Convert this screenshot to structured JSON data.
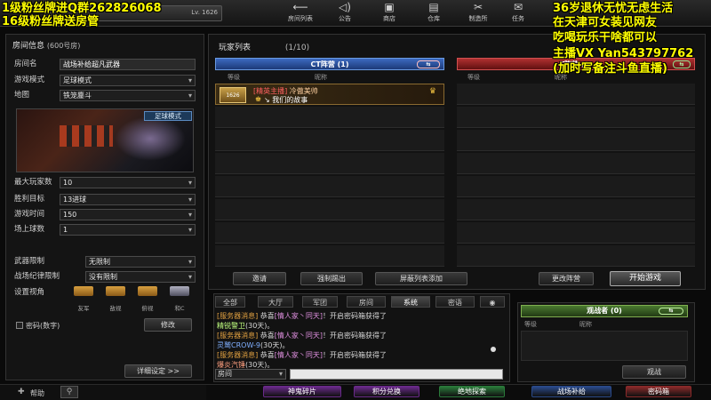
{
  "overlay": {
    "left_lines": [
      "1级粉丝牌进Q群262826068",
      "16级粉丝牌送房管"
    ],
    "right_lines": [
      "36岁退休无忧无虑生活",
      "在天津可女装见网友",
      "吃喝玩乐干啥都可以",
      "主播VX Yan543797762",
      "(加时写备注斗鱼直播)"
    ]
  },
  "topbar": {
    "level": "Lv. 1626",
    "nav": [
      {
        "label": "房间列表",
        "icon": "back-arrow-icon",
        "glyph": "⟵"
      },
      {
        "label": "公告",
        "icon": "speaker-icon",
        "glyph": "◁)"
      },
      {
        "label": "商店",
        "icon": "shop-icon",
        "glyph": "▣"
      },
      {
        "label": "仓库",
        "icon": "warehouse-icon",
        "glyph": "▤"
      },
      {
        "label": "制造所",
        "icon": "tools-icon",
        "glyph": "✂"
      },
      {
        "label": "任务",
        "icon": "mission-icon",
        "glyph": "✉"
      }
    ]
  },
  "room_info": {
    "title": "房间信息",
    "room_no": "(600号房)",
    "fields": [
      {
        "label": "房间名",
        "value": "战场补给超凡武器",
        "kind": "title"
      },
      {
        "label": "游戏模式",
        "value": "足球模式",
        "kind": "select"
      },
      {
        "label": "地图",
        "value": "铁笼鏖斗",
        "kind": "select"
      }
    ],
    "map_mode_tag": "足球模式",
    "settings": [
      {
        "label": "最大玩家数",
        "value": "10"
      },
      {
        "label": "胜利目标",
        "value": "13进球"
      },
      {
        "label": "游戏时间",
        "value": "150"
      },
      {
        "label": "场上球数",
        "value": "1"
      }
    ],
    "limits": [
      {
        "label": "武器限制",
        "value": "无限制"
      },
      {
        "label": "战场纪律限制",
        "value": "没有限制"
      }
    ],
    "view_label": "设置视角",
    "views": [
      "友军",
      "敌视",
      "俯视",
      "和C"
    ],
    "password_label": "密码(数字)",
    "modify_button": "修改",
    "detail_button": "详细设定 >>",
    "help": "帮助"
  },
  "player_list": {
    "title": "玩家列表",
    "count": "(1/10)",
    "ct_team": "CT阵营 (1)",
    "t_team": "T阵营 (0)",
    "col_level": "等级",
    "col_name": "昵称",
    "player": {
      "level": "1626",
      "rank_tag": "[精英主播]",
      "name": "冷傲美帅",
      "clan": "↘ 我们的故事",
      "rank_glyph": "♚",
      "crown_glyph": "♛"
    },
    "buttons": {
      "invite": "邀请",
      "kick": "强制踢出",
      "block": "屏蔽列表添加",
      "change_team": "更改阵营",
      "start": "开始游戏"
    }
  },
  "chat": {
    "tabs": [
      "全部",
      "大厅",
      "军团",
      "房间",
      "系统",
      "密语"
    ],
    "active_tab": "系统",
    "lines": [
      {
        "a": "[服务器消息]",
        "b": " 恭喜",
        "c": "[情人家丶同天]",
        "d": "！开启密码箱获得了"
      },
      {
        "a": "精锐警卫",
        "b": "(30天)",
        "c": "。",
        "d": ""
      },
      {
        "a": "[服务器消息]",
        "b": " 恭喜",
        "c": "[情人家丶同天]",
        "d": "！开启密码箱获得了"
      },
      {
        "a": "灵鹫CROW-9",
        "b": "(30天)",
        "c": "。",
        "d": ""
      },
      {
        "a": "[服务器消息]",
        "b": " 恭喜",
        "c": "[情人家丶同天]",
        "d": "！开启密码箱获得了"
      },
      {
        "a": "爆炎汽锤",
        "b": "(30天)",
        "c": "。",
        "d": ""
      }
    ],
    "channel": "房间"
  },
  "spectator": {
    "title": "观战者 (0)",
    "col_level": "等级",
    "col_name": "昵称",
    "button": "观战"
  },
  "bottom_buttons": [
    {
      "label": "神鬼碎片",
      "color": "#6a2a8a"
    },
    {
      "label": "积分兑换",
      "color": "#6a2a8a"
    },
    {
      "label": "绝地探索",
      "color": "#2a7a3a"
    },
    {
      "label": "战场补给",
      "color": "#2a4a8a"
    },
    {
      "label": "密码箱",
      "color": "#8a2a2a"
    }
  ]
}
